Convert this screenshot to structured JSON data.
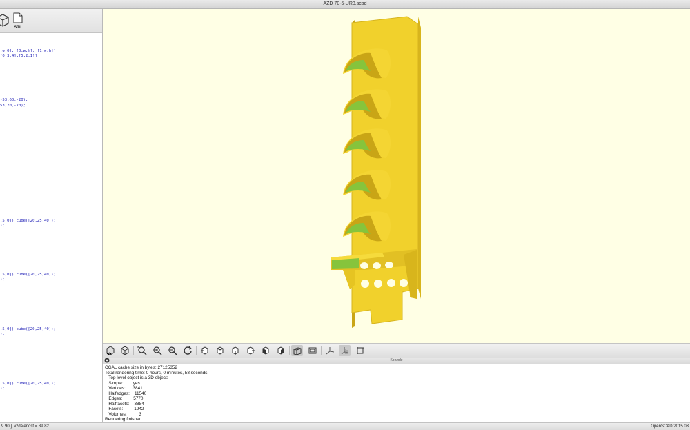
{
  "window": {
    "title": "AZD 70-5-UR3.scad"
  },
  "editor": {
    "stl_label": "STL",
    "code_lines": [
      ",w,0], [0,w,h], [1,w,h]],",
      "[0,3,4],[5,2,1]]",
      "-53,60,-20);",
      "53,20,-70);",
      ",5,0]) cube([20,25,40]);",
      ");",
      ",5,0]) cube([20,25,40]);",
      ");",
      ",5,0]) cube([20,25,40]);",
      ");",
      ",5,0]) cube([20,25,40]);",
      ");"
    ]
  },
  "console": {
    "title": "Konzole",
    "lines": [
      "CGAL cache size in bytes: 27125352",
      "Total rendering time: 0 hours, 0 minutes, 58 seconds",
      "   Top level object is a 3D object:",
      "   Simple:        yes",
      "   Vertices:      3841",
      "   Halfedges:    11540",
      "   Edges:         5770",
      "   Halffacets:    3884",
      "   Facets:         1942",
      "   Volumes:          3",
      "Rendering finished."
    ]
  },
  "statusbar": {
    "left": "9.90 ], vzdálenost = 39.82",
    "right": "OpenSCAD 2015.03"
  },
  "colors": {
    "viewport_bg": "#ffffe5",
    "model_face": "#f1d12c",
    "model_side": "#d8b51c",
    "model_inner": "#86c43c",
    "code_text": "#1a1ab4"
  },
  "icons": {
    "toolbar": [
      "cube-icon",
      "export-stl-icon"
    ],
    "view_toolbar": [
      "render-icon",
      "preview-icon",
      "zoom-all-icon",
      "zoom-in-icon",
      "zoom-out-icon",
      "reset-view-icon",
      "view-right-icon",
      "view-top-icon",
      "view-bottom-icon",
      "view-left-icon",
      "view-front-icon",
      "view-back-icon",
      "perspective-icon",
      "orthogonal-icon",
      "show-axes-icon",
      "show-scale-icon",
      "show-edges-icon"
    ]
  }
}
